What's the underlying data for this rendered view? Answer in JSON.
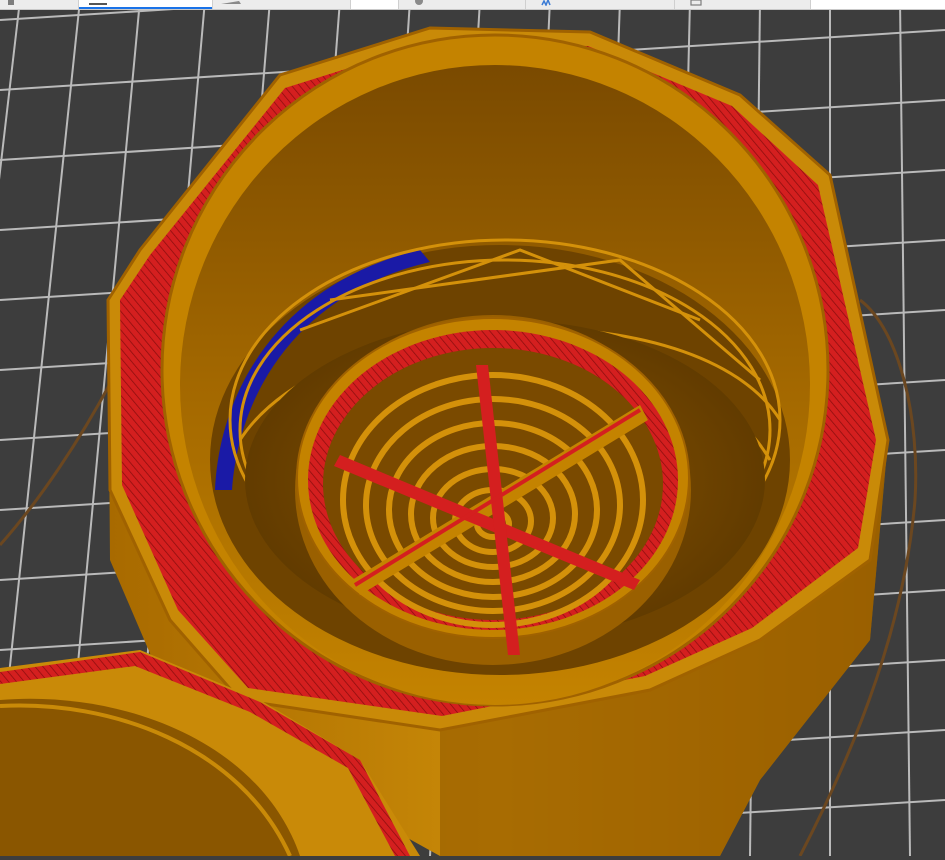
{
  "toolbar": {
    "tabs": [
      {
        "icon": "prepare-icon",
        "label": "",
        "active": false
      },
      {
        "icon": "preview-icon",
        "label": "",
        "active": true
      },
      {
        "icon": "layers-icon",
        "label": "",
        "active": false
      },
      {
        "icon": "blank-tab",
        "label": "",
        "active": false
      },
      {
        "icon": "settings-icon",
        "label": "",
        "active": false
      },
      {
        "icon": "graph-icon",
        "label": "",
        "active": false
      },
      {
        "icon": "device-icon",
        "label": "",
        "active": false
      }
    ]
  },
  "scene": {
    "background_color": "#3d3d3d",
    "grid_color": "#dcdcdc",
    "filament_color": "#d4910a",
    "wall_color": "#8a5600",
    "top_infill_color": "#d41f1f",
    "support_color": "#1a1aa6",
    "travel_color": "#6b4720"
  }
}
